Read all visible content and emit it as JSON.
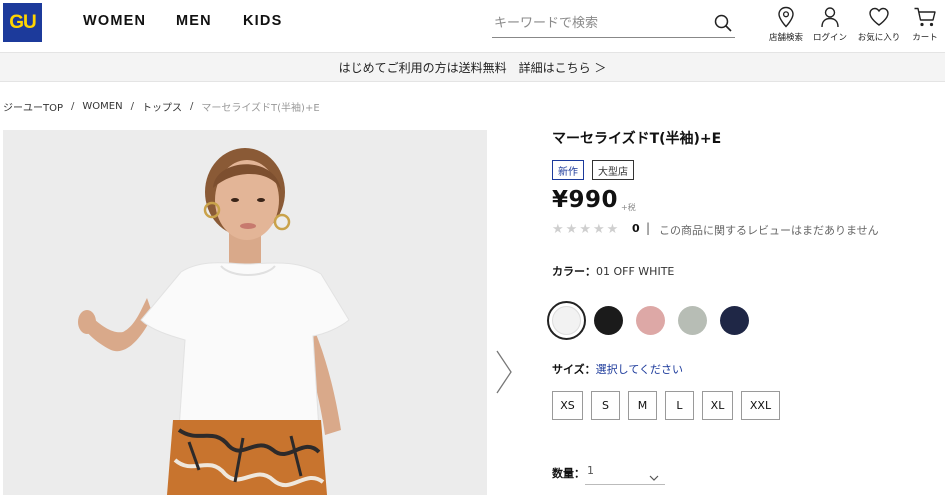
{
  "brand": {
    "logo_text": "GU",
    "logo_color": "#1c3a9b",
    "logo_text_color": "#ffd400"
  },
  "nav": {
    "items": [
      "WOMEN",
      "MEN",
      "KIDS"
    ]
  },
  "search": {
    "placeholder": "キーワードで検索"
  },
  "utility": {
    "items": [
      {
        "label": "店舗検索",
        "icon": "location-pin-icon"
      },
      {
        "label": "ログイン",
        "icon": "user-icon"
      },
      {
        "label": "お気に入り",
        "icon": "heart-icon"
      },
      {
        "label": "カート",
        "icon": "cart-icon"
      }
    ]
  },
  "banner": {
    "text": "はじめてご利用の方は送料無料　詳細はこちら ＞"
  },
  "breadcrumb": {
    "items": [
      "ジーユーTOP",
      "WOMEN",
      "トップス",
      "マーセライズドT(半袖)+E"
    ],
    "separator": "/"
  },
  "product": {
    "title": "マーセライズドT(半袖)+E",
    "badges": [
      "新作",
      "大型店"
    ],
    "price": "¥990",
    "tax_label": "+税",
    "rating": {
      "stars_filled": 0,
      "stars_total": 5,
      "count": "0",
      "separator": "|",
      "message": "この商品に関するレビューはまだありません"
    },
    "color": {
      "label": "カラー：",
      "selected": "01 OFF WHITE",
      "swatches": [
        {
          "name": "off-white",
          "hex": "#f2f2f2"
        },
        {
          "name": "black",
          "hex": "#1b1b1b"
        },
        {
          "name": "pink",
          "hex": "#dda8a6"
        },
        {
          "name": "sage-gray",
          "hex": "#b7bdb5"
        },
        {
          "name": "navy",
          "hex": "#1f2746"
        }
      ]
    },
    "size": {
      "label": "サイズ：",
      "prompt": "選択してください",
      "options": [
        "XS",
        "S",
        "M",
        "L",
        "XL",
        "XXL"
      ]
    },
    "quantity": {
      "label": "数量：",
      "value": "1"
    }
  }
}
